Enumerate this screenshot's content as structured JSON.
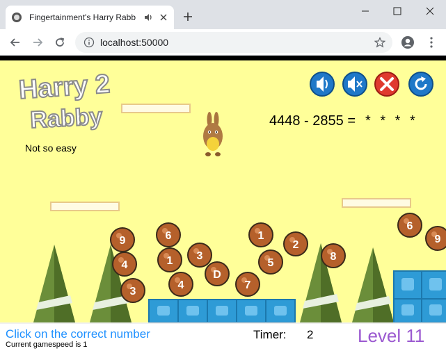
{
  "browser": {
    "tab_title": "Fingertainment's Harry Rabb",
    "url": "localhost:50000"
  },
  "game": {
    "logo_line1": "Harry 2",
    "logo_line2": "Rabby",
    "difficulty": "Not so easy",
    "equation": "4448 - 2855 =",
    "answer_mask": "* * * *",
    "controls": [
      "sound-on",
      "mute",
      "exit",
      "restart"
    ],
    "balls": [
      "9",
      "4",
      "3",
      "6",
      "1",
      "4",
      "3",
      "D",
      "7",
      "1",
      "5",
      "2",
      "8",
      "6",
      "9"
    ]
  },
  "status": {
    "instruction": "Click on the correct number",
    "gamespeed": "Current gamespeed is 1",
    "timer_label": "Timer:",
    "timer_value": "2",
    "level": "Level 11"
  },
  "colors": {
    "background": "#ffff99",
    "ball": "#b5602b",
    "tree": "#6b8e3a",
    "block": "#2e9bd6",
    "button_blue": "#1f78c8",
    "button_red": "#e03a2f",
    "level_text": "#9b59d0",
    "instruction_text": "#1e90ff"
  }
}
